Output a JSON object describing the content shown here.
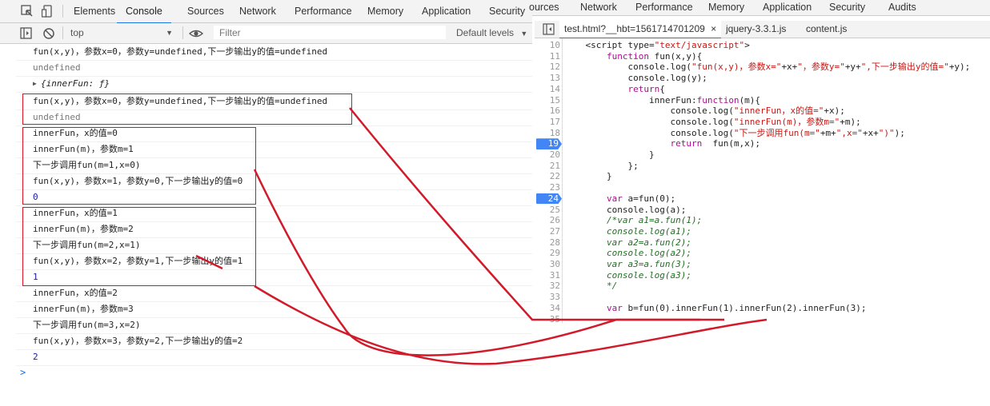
{
  "devtools_tabs": [
    "Elements",
    "Console",
    "Sources",
    "Network",
    "Performance",
    "Memory",
    "Application",
    "Security"
  ],
  "devtools_tabs_right": [
    "ources",
    "Network",
    "Performance",
    "Memory",
    "Application",
    "Security",
    "Audits"
  ],
  "console_toolbar": {
    "context": "top",
    "filter_placeholder": "Filter",
    "levels": "Default levels"
  },
  "source_tabs": [
    "test.html?__hbt=1561714701209",
    "jquery-3.3.1.js",
    "content.js"
  ],
  "console_lines": [
    "fun(x,y)，参数x=0，参数y=undefined,下一步输出y的值=undefined",
    "undefined",
    "{innerFun: ƒ}",
    "fun(x,y)，参数x=0，参数y=undefined,下一步输出y的值=undefined",
    "undefined",
    "innerFun，x的值=0",
    "innerFun(m)，参数m=1",
    "下一步调用fun(m=1,x=0)",
    "fun(x,y)，参数x=1，参数y=0,下一步输出y的值=0",
    "0",
    "innerFun，x的值=1",
    "innerFun(m)，参数m=2",
    "下一步调用fun(m=2,x=1)",
    "fun(x,y)，参数x=2，参数y=1,下一步输出y的值=1",
    "1",
    "innerFun，x的值=2",
    "innerFun(m)，参数m=3",
    "下一步调用fun(m=3,x=2)",
    "fun(x,y)，参数x=3，参数y=2,下一步输出y的值=2",
    "2"
  ],
  "console_prompt": ">",
  "line_numbers": [
    "10",
    "11",
    "12",
    "13",
    "14",
    "15",
    "16",
    "17",
    "18",
    "19",
    "20",
    "21",
    "22",
    "23",
    "24",
    "25",
    "26",
    "27",
    "28",
    "29",
    "30",
    "31",
    "32",
    "33",
    "34",
    "35"
  ],
  "source_lines": [
    "    <script type=\"text/javascript\">",
    "        function fun(x,y){",
    "            console.log(\"fun(x,y)，参数x=\"+x+\"，参数y=\"+y+\",下一步输出y的值=\"+y);",
    "            console.log(y);",
    "            return{",
    "                innerFun:function(m){",
    "                    console.log(\"innerFun，x的值=\"+x);",
    "                    console.log(\"innerFun(m)，参数m=\"+m);",
    "                    console.log(\"下一步调用fun(m=\"+m+\",x=\"+x+\")\");",
    "                    return  fun(m,x);",
    "                }",
    "            };",
    "        }",
    "",
    "        var a=fun(0);",
    "        console.log(a);",
    "        /*var a1=a.fun(1);",
    "        console.log(a1);",
    "        var a2=a.fun(2);",
    "        console.log(a2);",
    "        var a3=a.fun(3);",
    "        console.log(a3);",
    "        */",
    "",
    "        var b=fun(0).innerFun(1).innerFun(2).innerFun(3);",
    ""
  ],
  "colors": {
    "annotation": "#d11a2a",
    "breakpoint": "#4285f4",
    "active_tab": "#1a73e8"
  }
}
